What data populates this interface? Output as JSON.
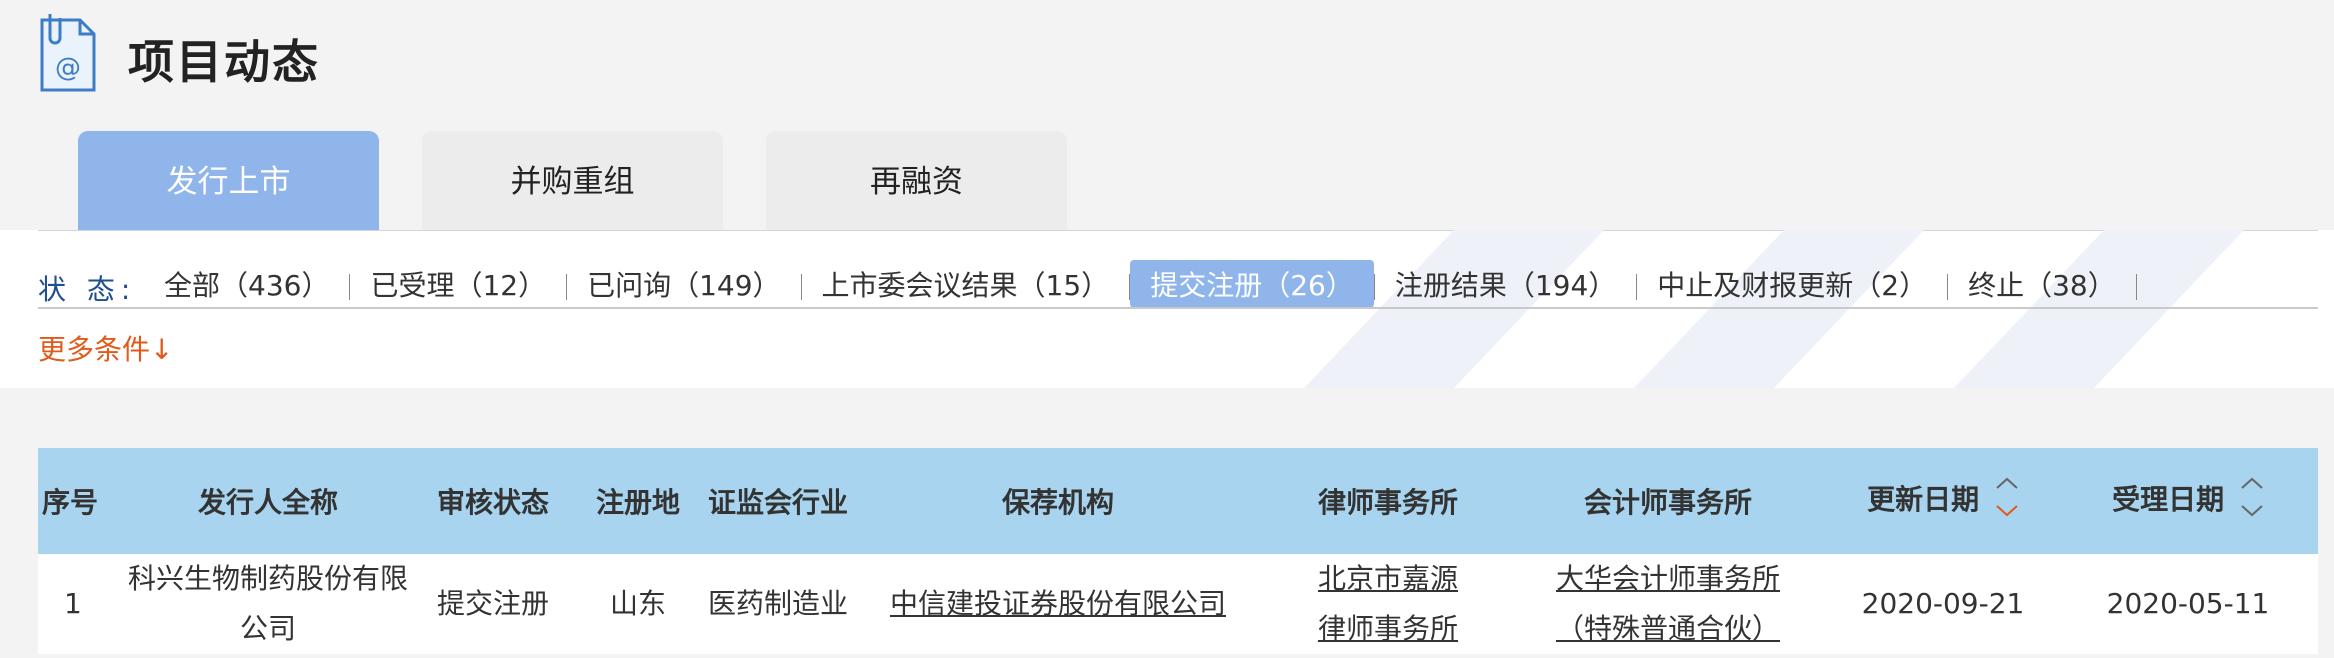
{
  "header": {
    "title": "项目动态"
  },
  "tabs": [
    {
      "label": "发行上市",
      "active": true
    },
    {
      "label": "并购重组",
      "active": false
    },
    {
      "label": "再融资",
      "active": false
    }
  ],
  "filters": {
    "status_label": "状  态:",
    "options": [
      {
        "label": "全部（436）",
        "active": false
      },
      {
        "label": "已受理（12）",
        "active": false
      },
      {
        "label": "已问询（149）",
        "active": false
      },
      {
        "label": "上市委会议结果（15）",
        "active": false
      },
      {
        "label": "提交注册（26）",
        "active": true
      },
      {
        "label": "注册结果（194）",
        "active": false
      },
      {
        "label": "中止及财报更新（2）",
        "active": false
      },
      {
        "label": "终止（38）",
        "active": false
      }
    ],
    "more_label": "更多条件↓"
  },
  "table": {
    "columns": [
      "序号",
      "发行人全称",
      "审核状态",
      "注册地",
      "证监会行业",
      "保荐机构",
      "律师事务所",
      "会计师事务所",
      "更新日期",
      "受理日期"
    ],
    "rows": [
      {
        "seq": "1",
        "issuer": "科兴生物制药股份有限公司",
        "status": "提交注册",
        "location": "山东",
        "industry": "医药制造业",
        "sponsor": "中信建投证券股份有限公司",
        "law_firm_line1": "北京市嘉源",
        "law_firm_line2": "律师事务所",
        "accounting_line1": "大华会计师事务所",
        "accounting_line2": "（特殊普通合伙）",
        "updated": "2020-09-21",
        "accepted": "2020-05-11"
      }
    ]
  },
  "colors": {
    "accent": "#8fb5ea",
    "header_bg": "#a8d4ef",
    "orange": "#e15a19",
    "status_label": "#1d4f91"
  }
}
